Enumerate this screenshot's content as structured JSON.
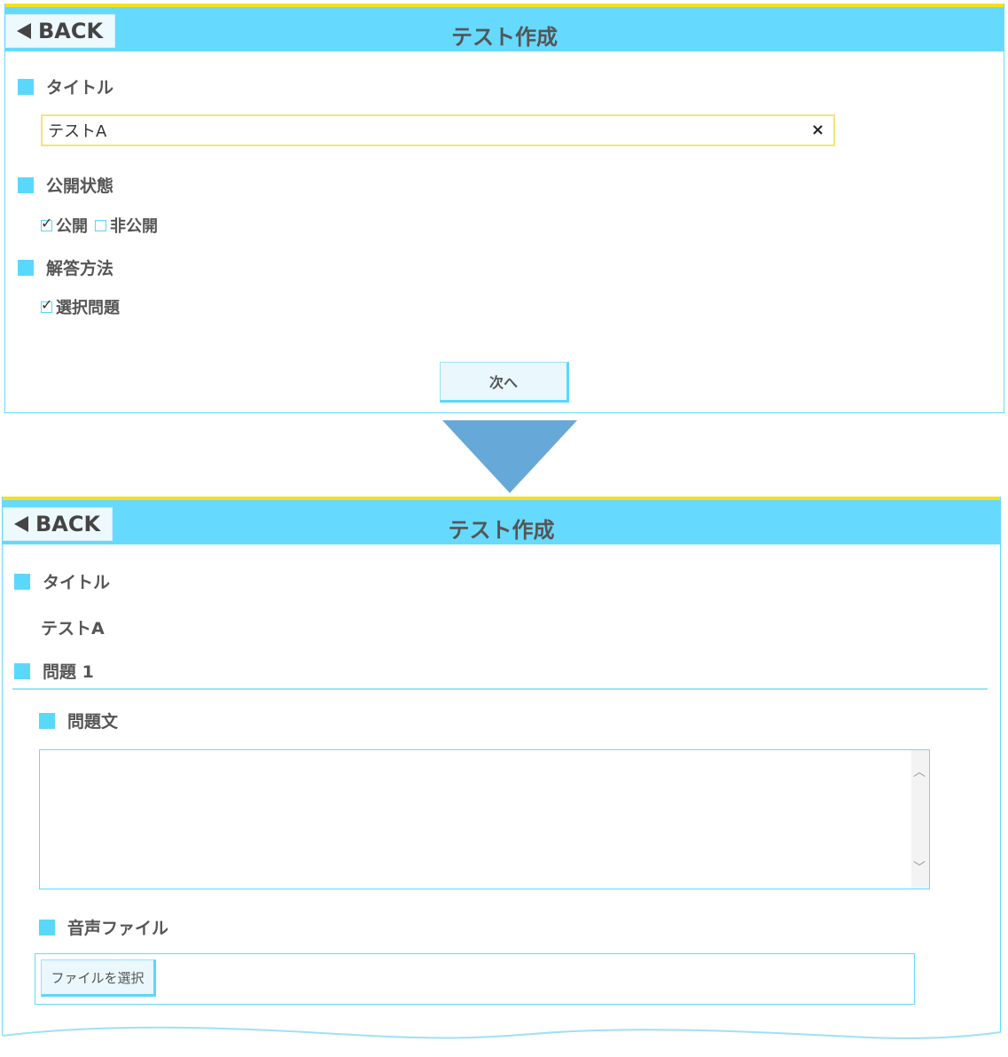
{
  "colors": {
    "accent": "#66d9ff",
    "header_top": "#f5e11a",
    "arrow": "#66a8d8"
  },
  "screen1": {
    "back_label": "BACK",
    "header_title": "テスト作成",
    "title_label": "タイトル",
    "title_value": "テストA",
    "clear_icon": "×",
    "visibility_label": "公開状態",
    "visibility_options": [
      {
        "label": "公開",
        "checked": true
      },
      {
        "label": "非公開",
        "checked": false
      }
    ],
    "answer_method_label": "解答方法",
    "answer_method_option": {
      "label": "選択問題",
      "checked": true
    },
    "next_button": "次へ"
  },
  "screen2": {
    "back_label": "BACK",
    "header_title": "テスト作成",
    "title_label": "タイトル",
    "title_value": "テストA",
    "question_label": "問題 1",
    "question_text_label": "問題文",
    "question_text_value": "",
    "audio_file_label": "音声ファイル",
    "choose_file_button": "ファイルを選択"
  }
}
